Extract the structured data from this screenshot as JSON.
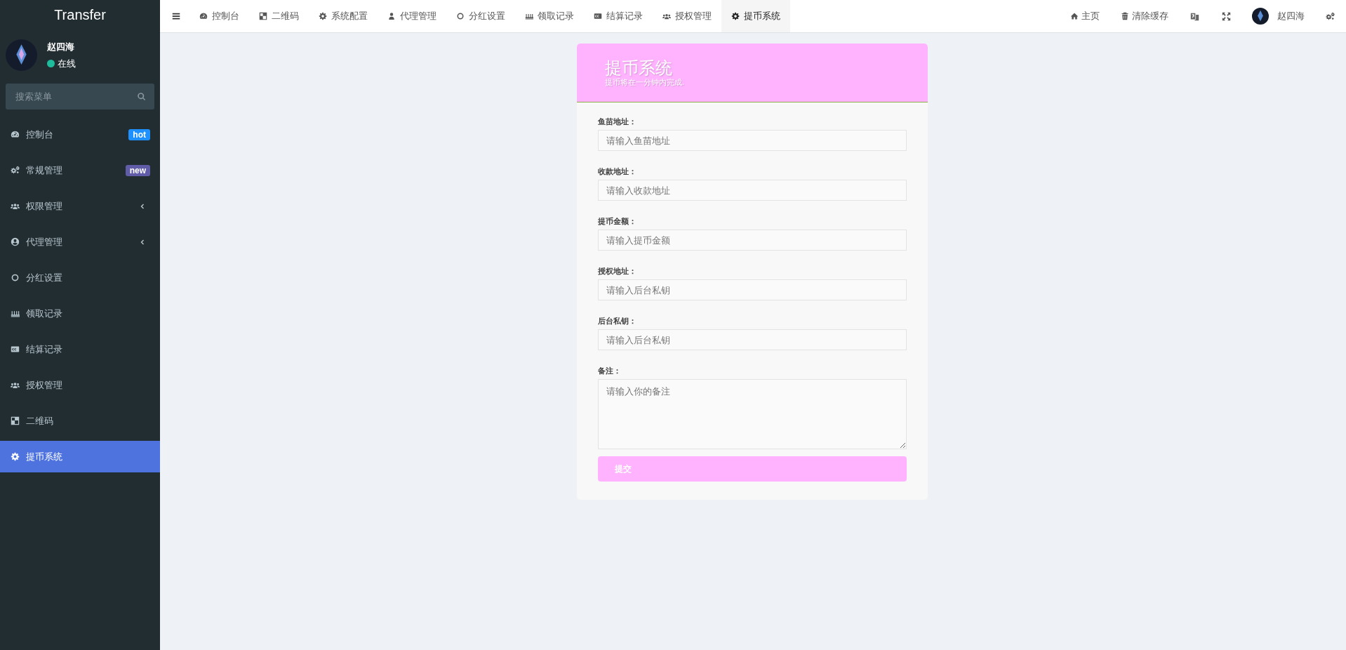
{
  "sidebar": {
    "logo": "Transfer",
    "user": {
      "name": "赵四海",
      "status": "在线",
      "online": true
    },
    "search": {
      "placeholder": "搜索菜单"
    },
    "items": [
      {
        "label": "控制台",
        "kind": "link",
        "selected": false,
        "badge": {
          "text": "hot",
          "color": "#1e90ff"
        }
      },
      {
        "label": "常规管理",
        "kind": "link",
        "selected": false,
        "badge": {
          "text": "new",
          "color": "#605ca8"
        }
      },
      {
        "label": "权限管理",
        "kind": "group",
        "expanded": false,
        "selected": false
      },
      {
        "label": "代理管理",
        "kind": "group",
        "expanded": false,
        "selected": false
      },
      {
        "label": "分红设置",
        "kind": "link",
        "selected": false
      },
      {
        "label": "领取记录",
        "kind": "link",
        "selected": false
      },
      {
        "label": "结算记录",
        "kind": "link",
        "selected": false
      },
      {
        "label": "授权管理",
        "kind": "link",
        "selected": false
      },
      {
        "label": "二维码",
        "kind": "link",
        "selected": false
      },
      {
        "label": "提币系统",
        "kind": "link",
        "selected": true
      }
    ]
  },
  "tabs": [
    {
      "label": "控制台",
      "selected": false
    },
    {
      "label": "二维码",
      "selected": false
    },
    {
      "label": "系统配置",
      "selected": false
    },
    {
      "label": "代理管理",
      "selected": false
    },
    {
      "label": "分红设置",
      "selected": false
    },
    {
      "label": "领取记录",
      "selected": false
    },
    {
      "label": "结算记录",
      "selected": false
    },
    {
      "label": "授权管理",
      "selected": false
    },
    {
      "label": "提币系统",
      "selected": true
    }
  ],
  "top_right": {
    "home": "主页",
    "clear_cache": "清除缓存",
    "user_name": "赵四海"
  },
  "panel": {
    "title": "提币系统",
    "subtitle": "提币将在一分钟内完成.",
    "fields": [
      {
        "kind": "input",
        "label": "鱼苗地址：",
        "placeholder": "请输入鱼苗地址"
      },
      {
        "kind": "input",
        "label": "收款地址：",
        "placeholder": "请输入收款地址"
      },
      {
        "kind": "input",
        "label": "提币金额：",
        "placeholder": "请输入提币金额"
      },
      {
        "kind": "input",
        "label": "授权地址：",
        "placeholder": "请输入后台私钥"
      },
      {
        "kind": "input",
        "label": "后台私钥：",
        "placeholder": "请输入后台私钥"
      },
      {
        "kind": "textarea",
        "label": "备注：",
        "placeholder": "请输入你的备注"
      }
    ],
    "submit": "提交"
  }
}
